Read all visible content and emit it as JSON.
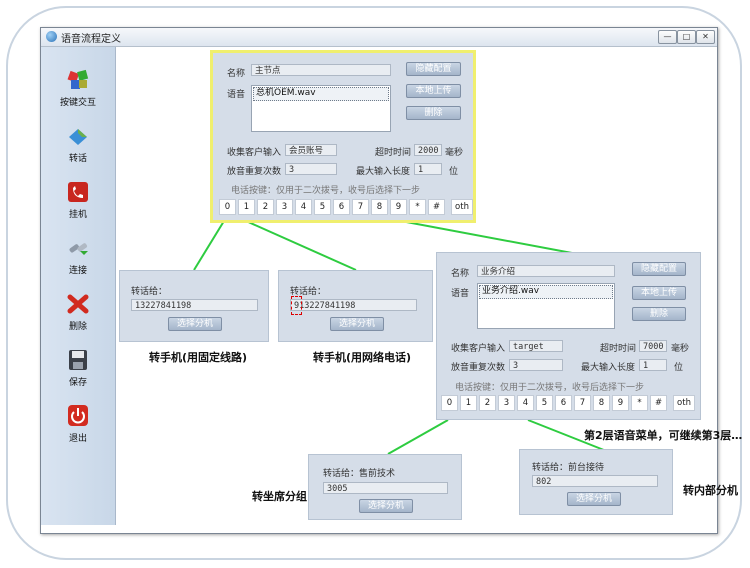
{
  "window": {
    "title": "语音流程定义",
    "min_glyph": "—",
    "max_glyph": "□",
    "close_glyph": "✕"
  },
  "sidebar": {
    "items": [
      {
        "label": "按键交互",
        "icon": "key-interaction-icon"
      },
      {
        "label": "转话",
        "icon": "transfer-icon"
      },
      {
        "label": "挂机",
        "icon": "hang-up-icon"
      },
      {
        "label": "连接",
        "icon": "connect-icon"
      },
      {
        "label": "删除",
        "icon": "delete-icon"
      },
      {
        "label": "保存",
        "icon": "save-icon"
      },
      {
        "label": "退出",
        "icon": "exit-icon"
      }
    ]
  },
  "main_node": {
    "name_label": "名称",
    "name_value": "主节点",
    "voice_label": "语音",
    "voice_item": "总机OEM.wav",
    "hide_config": "隐藏配置",
    "local_upload": "本地上传",
    "delete": "删除",
    "collect_label": "收集客户输入",
    "collect_value": "会员账号",
    "timeout_label": "超时时间",
    "timeout_value": "2000",
    "timeout_unit": "毫秒",
    "repeat_label": "放音重复次数",
    "repeat_value": "3",
    "maxlen_label": "最大输入长度",
    "maxlen_value": "1",
    "maxlen_unit": "位",
    "hint": "电话按键：仅用于二次拨号，收号后选择下一步",
    "keys": [
      "0",
      "1",
      "2",
      "3",
      "4",
      "5",
      "6",
      "7",
      "8",
      "9",
      "*",
      "#"
    ],
    "other_key": "oth"
  },
  "transfer1": {
    "label": "转话给：",
    "value": "13227841198",
    "button": "选择分机",
    "caption": "转手机(用固定线路)"
  },
  "transfer2": {
    "label": "转话给：",
    "value": "913227841198",
    "button": "选择分机",
    "caption": "转手机(用网络电话)"
  },
  "second_node": {
    "name_label": "名称",
    "name_value": "业务介绍",
    "voice_label": "语音",
    "voice_item": "业务介绍.wav",
    "hide_config": "隐藏配置",
    "local_upload": "本地上传",
    "delete": "删除",
    "collect_label": "收集客户输入",
    "collect_value": "target",
    "timeout_label": "超时时间",
    "timeout_value": "7000",
    "timeout_unit": "毫秒",
    "repeat_label": "放音重复次数",
    "repeat_value": "3",
    "maxlen_label": "最大输入长度",
    "maxlen_value": "1",
    "maxlen_unit": "位",
    "hint": "电话按键：仅用于二次拨号，收号后选择下一步",
    "keys": [
      "0",
      "1",
      "2",
      "3",
      "4",
      "5",
      "6",
      "7",
      "8",
      "9",
      "*",
      "#"
    ],
    "other_key": "oth",
    "caption": "第2层语音菜单，可继续第3层…"
  },
  "transfer3": {
    "label": "转话给：售前技术",
    "value": "3005",
    "button": "选择分机",
    "caption": "转坐席分组"
  },
  "transfer4": {
    "label": "转话给：前台接待",
    "value": "802",
    "button": "选择分机",
    "caption": "转内部分机"
  },
  "colors": {
    "connector": "#2ecc40",
    "main_border": "#f0ef6e",
    "node_bg": "#d5dde8",
    "button": "#a4b5ca"
  }
}
